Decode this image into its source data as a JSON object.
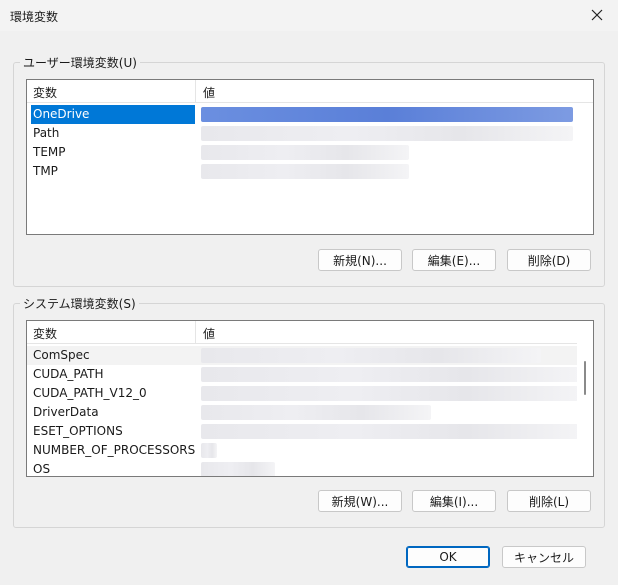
{
  "window": {
    "title": "環境変数"
  },
  "user_group": {
    "legend": "ユーザー環境変数(U)",
    "columns": {
      "name": "変数",
      "value": "値"
    },
    "rows": [
      {
        "name": "OneDrive",
        "selected": true
      },
      {
        "name": "Path"
      },
      {
        "name": "TEMP"
      },
      {
        "name": "TMP"
      }
    ],
    "buttons": {
      "new": "新規(N)...",
      "edit": "編集(E)...",
      "delete": "削除(D)"
    }
  },
  "system_group": {
    "legend": "システム環境変数(S)",
    "columns": {
      "name": "変数",
      "value": "値"
    },
    "rows": [
      {
        "name": "ComSpec"
      },
      {
        "name": "CUDA_PATH"
      },
      {
        "name": "CUDA_PATH_V12_0"
      },
      {
        "name": "DriverData"
      },
      {
        "name": "ESET_OPTIONS"
      },
      {
        "name": "NUMBER_OF_PROCESSORS"
      },
      {
        "name": "OS"
      }
    ],
    "buttons": {
      "new": "新規(W)...",
      "edit": "編集(I)...",
      "delete": "削除(L)"
    }
  },
  "footer": {
    "ok": "OK",
    "cancel": "キャンセル"
  },
  "colors": {
    "selection": "#0078d7",
    "primary_border": "#0067c0"
  }
}
